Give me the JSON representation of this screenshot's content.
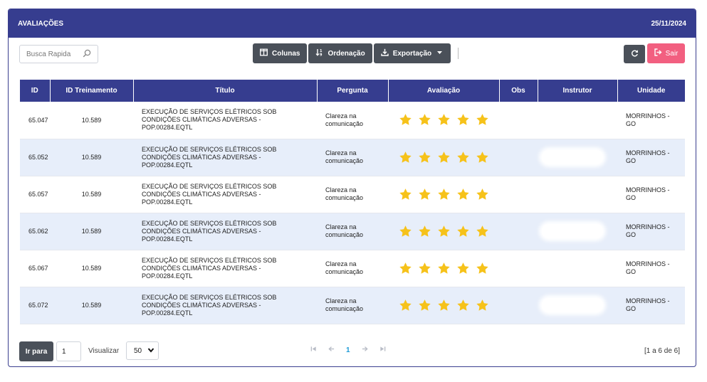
{
  "header": {
    "title": "AVALIAÇÕES",
    "date": "25/11/2024"
  },
  "toolbar": {
    "search_placeholder": "Busca Rapida",
    "columns_label": "Colunas",
    "order_label": "Ordenação",
    "export_label": "Exportação",
    "exit_label": "Sair"
  },
  "table": {
    "headers": [
      "ID",
      "ID Treinamento",
      "Título",
      "Pergunta",
      "Avaliação",
      "Obs",
      "Instrutor",
      "Unidade"
    ],
    "rows": [
      {
        "id": "65.047",
        "training": "10.589",
        "title_l1": "EXECUÇÃO DE SERVIÇOS ELÉTRICOS SOB",
        "title_l2": "CONDIÇÕES CLIMÁTICAS ADVERSAS -",
        "title_l3": "POP.00284.EQTL",
        "q_l1": "Clareza na",
        "q_l2": "comunicação",
        "rating": 5,
        "unit_l1": "MORRINHOS -",
        "unit_l2": "GO"
      },
      {
        "id": "65.052",
        "training": "10.589",
        "title_l1": "EXECUÇÃO DE SERVIÇOS ELÉTRICOS SOB",
        "title_l2": "CONDIÇÕES CLIMÁTICAS ADVERSAS -",
        "title_l3": "POP.00284.EQTL",
        "q_l1": "Clareza na",
        "q_l2": "comunicação",
        "rating": 5,
        "unit_l1": "MORRINHOS -",
        "unit_l2": "GO"
      },
      {
        "id": "65.057",
        "training": "10.589",
        "title_l1": "EXECUÇÃO DE SERVIÇOS ELÉTRICOS SOB",
        "title_l2": "CONDIÇÕES CLIMÁTICAS ADVERSAS -",
        "title_l3": "POP.00284.EQTL",
        "q_l1": "Clareza na",
        "q_l2": "comunicação",
        "rating": 5,
        "unit_l1": "MORRINHOS -",
        "unit_l2": "GO"
      },
      {
        "id": "65.062",
        "training": "10.589",
        "title_l1": "EXECUÇÃO DE SERVIÇOS ELÉTRICOS SOB",
        "title_l2": "CONDIÇÕES CLIMÁTICAS ADVERSAS -",
        "title_l3": "POP.00284.EQTL",
        "q_l1": "Clareza na",
        "q_l2": "comunicação",
        "rating": 5,
        "unit_l1": "MORRINHOS -",
        "unit_l2": "GO"
      },
      {
        "id": "65.067",
        "training": "10.589",
        "title_l1": "EXECUÇÃO DE SERVIÇOS ELÉTRICOS SOB",
        "title_l2": "CONDIÇÕES CLIMÁTICAS ADVERSAS -",
        "title_l3": "POP.00284.EQTL",
        "q_l1": "Clareza na",
        "q_l2": "comunicação",
        "rating": 5,
        "unit_l1": "MORRINHOS -",
        "unit_l2": "GO"
      },
      {
        "id": "65.072",
        "training": "10.589",
        "title_l1": "EXECUÇÃO DE SERVIÇOS ELÉTRICOS SOB",
        "title_l2": "CONDIÇÕES CLIMÁTICAS ADVERSAS -",
        "title_l3": "POP.00284.EQTL",
        "q_l1": "Clareza na",
        "q_l2": "comunicação",
        "rating": 5,
        "unit_l1": "MORRINHOS -",
        "unit_l2": "GO"
      }
    ]
  },
  "footer": {
    "goto_label": "Ir para",
    "page_value": "1",
    "view_label": "Visualizar",
    "page_size": "50",
    "current_page": "1",
    "range_text": "[1 a 6 de 6]"
  },
  "colors": {
    "header": "#363d8f",
    "star": "#f6c21a",
    "exit": "#f25f80",
    "row_alt": "#e7eefa"
  }
}
